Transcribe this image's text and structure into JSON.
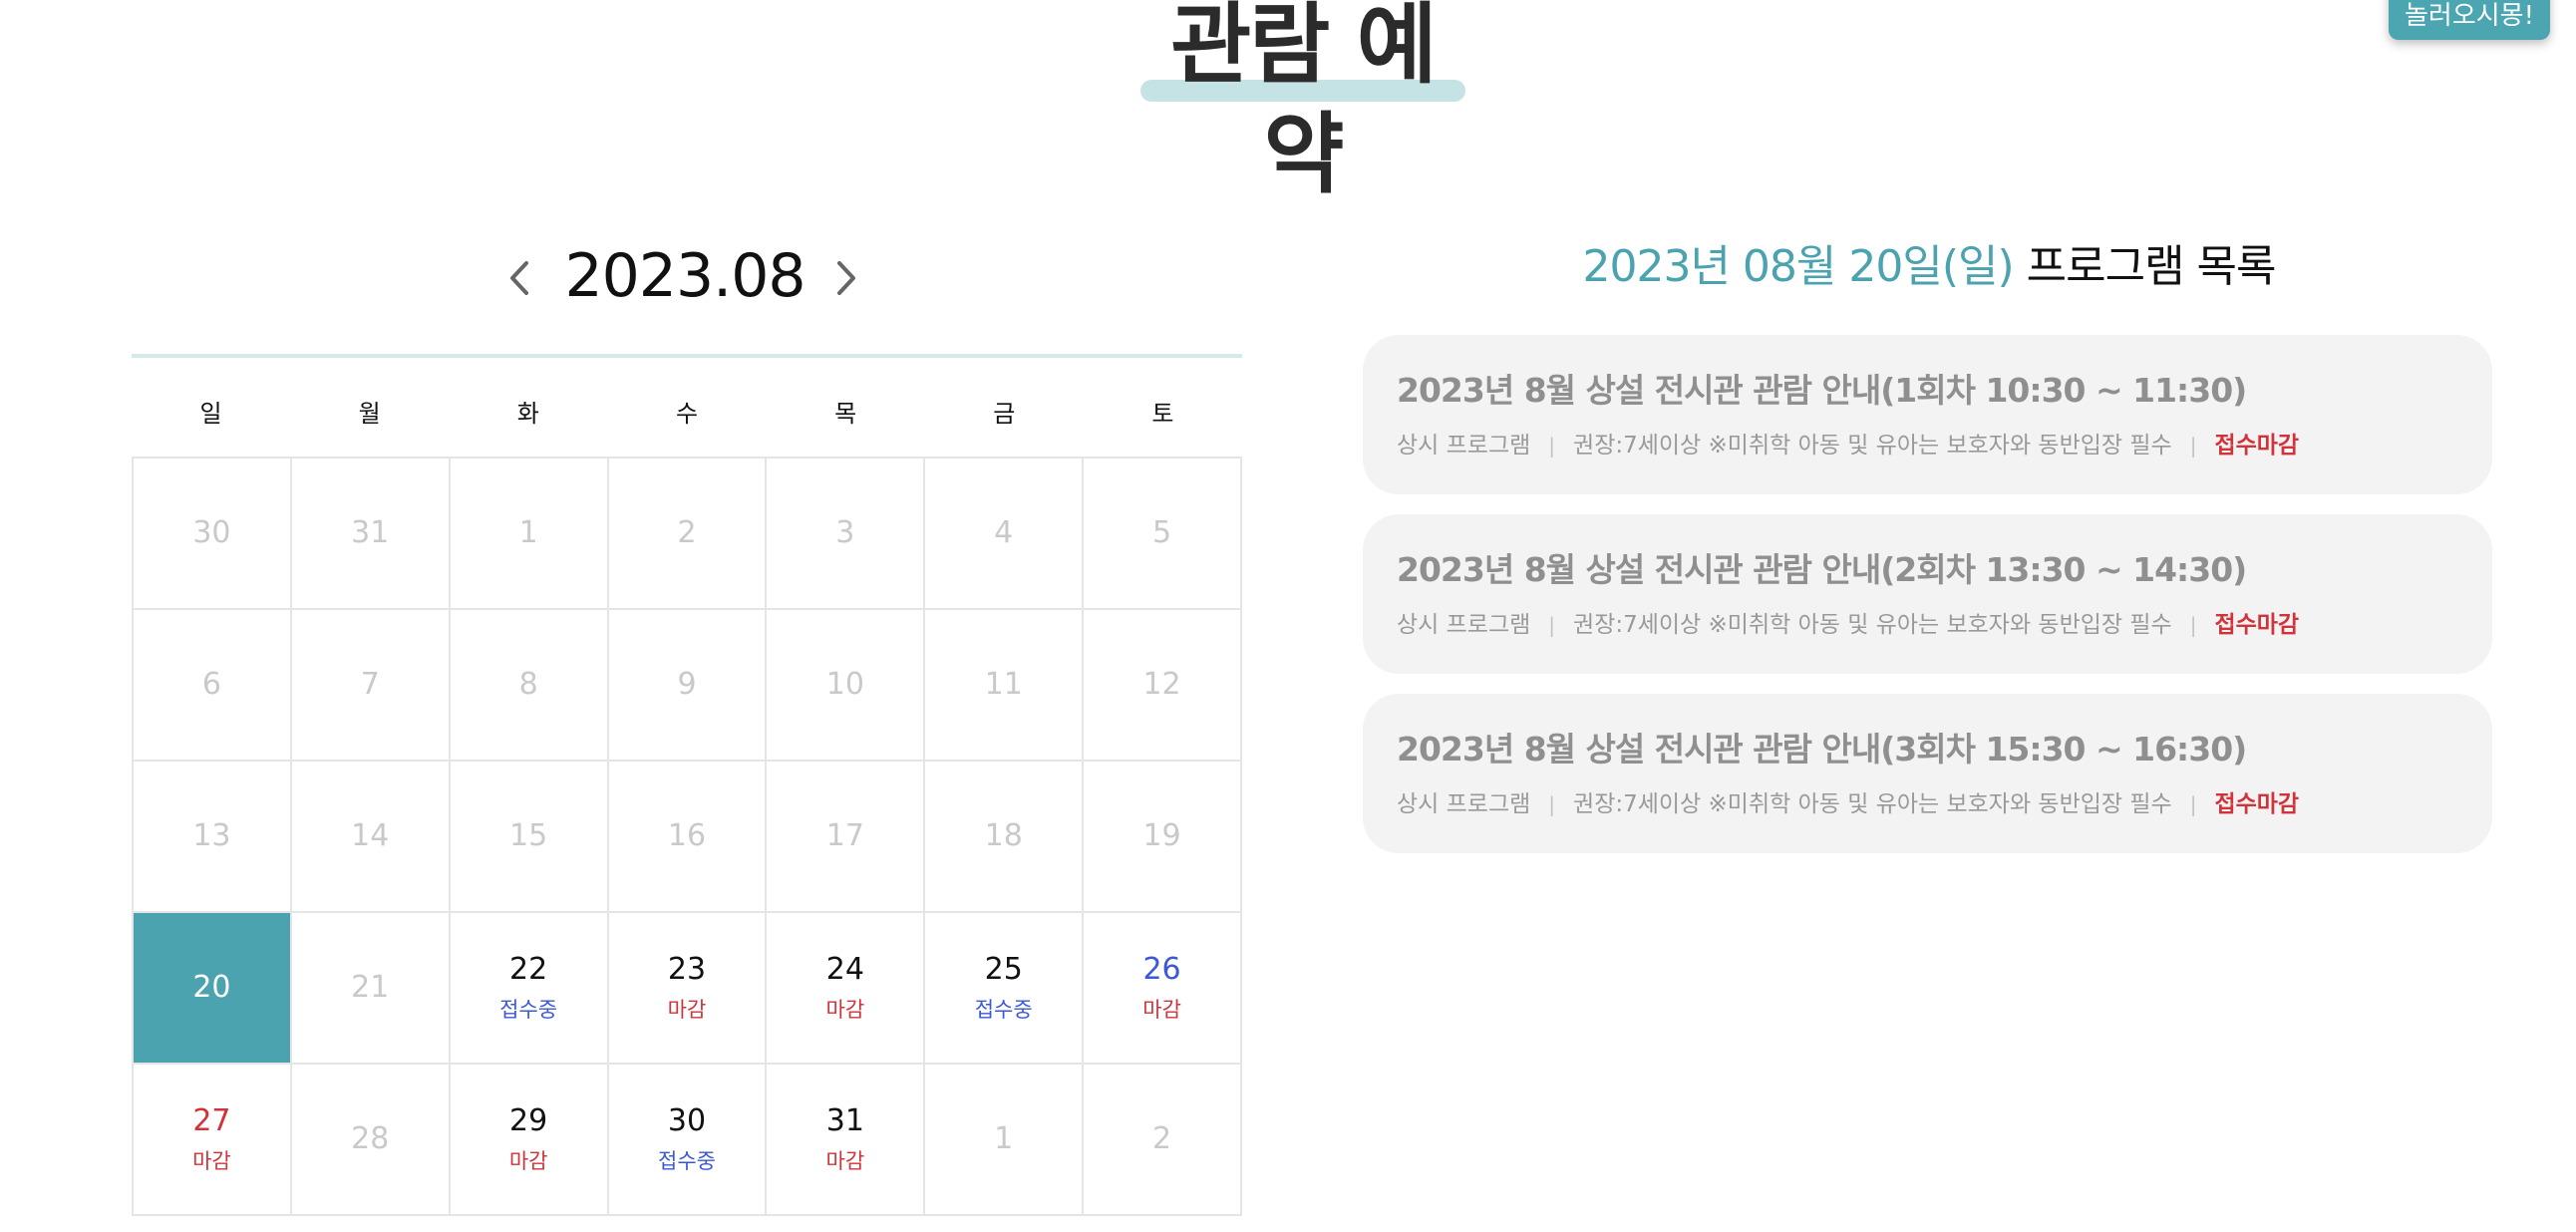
{
  "page": {
    "title": "관람 예약",
    "floating_button": "놀러오시몽!"
  },
  "calendar": {
    "month_label": "2023.08",
    "weekdays": [
      "일",
      "월",
      "화",
      "수",
      "목",
      "금",
      "토"
    ],
    "colors": {
      "past": "#c9c9c9",
      "normal": "#111111",
      "sunday": "#d0333a",
      "saturday": "#3d58d6",
      "status_open": "#3d58d6",
      "status_closed": "#d0333a",
      "selected_bg": "#4aa3af",
      "selected_text": "#ffffff"
    },
    "days": [
      {
        "day": "30",
        "status": "",
        "state": "past"
      },
      {
        "day": "31",
        "status": "",
        "state": "past"
      },
      {
        "day": "1",
        "status": "",
        "state": "past"
      },
      {
        "day": "2",
        "status": "",
        "state": "past"
      },
      {
        "day": "3",
        "status": "",
        "state": "past"
      },
      {
        "day": "4",
        "status": "",
        "state": "past"
      },
      {
        "day": "5",
        "status": "",
        "state": "past"
      },
      {
        "day": "6",
        "status": "",
        "state": "past"
      },
      {
        "day": "7",
        "status": "",
        "state": "past"
      },
      {
        "day": "8",
        "status": "",
        "state": "past"
      },
      {
        "day": "9",
        "status": "",
        "state": "past"
      },
      {
        "day": "10",
        "status": "",
        "state": "past"
      },
      {
        "day": "11",
        "status": "",
        "state": "past"
      },
      {
        "day": "12",
        "status": "",
        "state": "past"
      },
      {
        "day": "13",
        "status": "",
        "state": "past"
      },
      {
        "day": "14",
        "status": "",
        "state": "past"
      },
      {
        "day": "15",
        "status": "",
        "state": "past"
      },
      {
        "day": "16",
        "status": "",
        "state": "past"
      },
      {
        "day": "17",
        "status": "",
        "state": "past"
      },
      {
        "day": "18",
        "status": "",
        "state": "past"
      },
      {
        "day": "19",
        "status": "",
        "state": "past"
      },
      {
        "day": "20",
        "status": "",
        "state": "selected"
      },
      {
        "day": "21",
        "status": "",
        "state": "past"
      },
      {
        "day": "22",
        "status": "접수중",
        "state": "normal",
        "status_type": "open"
      },
      {
        "day": "23",
        "status": "마감",
        "state": "normal",
        "status_type": "closed"
      },
      {
        "day": "24",
        "status": "마감",
        "state": "normal",
        "status_type": "closed"
      },
      {
        "day": "25",
        "status": "접수중",
        "state": "normal",
        "status_type": "open"
      },
      {
        "day": "26",
        "status": "마감",
        "state": "saturday",
        "status_type": "closed"
      },
      {
        "day": "27",
        "status": "마감",
        "state": "sunday",
        "status_type": "closed"
      },
      {
        "day": "28",
        "status": "",
        "state": "past"
      },
      {
        "day": "29",
        "status": "마감",
        "state": "normal",
        "status_type": "closed"
      },
      {
        "day": "30",
        "status": "접수중",
        "state": "normal",
        "status_type": "open"
      },
      {
        "day": "31",
        "status": "마감",
        "state": "normal",
        "status_type": "closed"
      },
      {
        "day": "1",
        "status": "",
        "state": "past"
      },
      {
        "day": "2",
        "status": "",
        "state": "past"
      }
    ]
  },
  "programs": {
    "date_label": "2023년 08월 20일(일)",
    "title_suffix": "프로그램 목록",
    "items": [
      {
        "title": "2023년 8월 상설 전시관 관람 안내(1회차 10:30 ~ 11:30)",
        "category": "상시 프로그램",
        "age": "권장:7세이상 ※미취학 아동 및 유아는 보호자와 동반입장 필수",
        "status": "접수마감"
      },
      {
        "title": "2023년 8월 상설 전시관 관람 안내(2회차 13:30 ~ 14:30)",
        "category": "상시 프로그램",
        "age": "권장:7세이상 ※미취학 아동 및 유아는 보호자와 동반입장 필수",
        "status": "접수마감"
      },
      {
        "title": "2023년 8월 상설 전시관 관람 안내(3회차 15:30 ~ 16:30)",
        "category": "상시 프로그램",
        "age": "권장:7세이상 ※미취학 아동 및 유아는 보호자와 동반입장 필수",
        "status": "접수마감"
      }
    ],
    "separator": "|"
  }
}
